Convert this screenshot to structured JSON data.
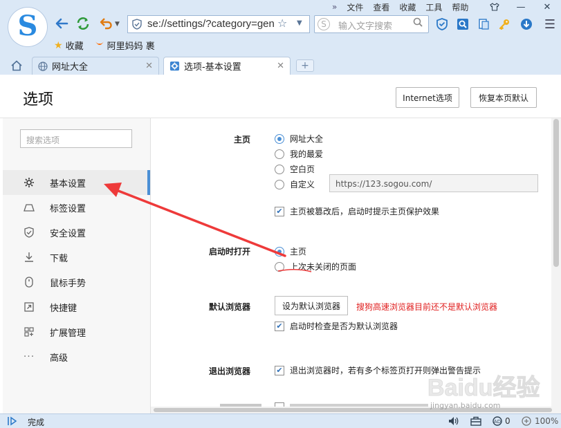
{
  "menu": {
    "chevrons": "»",
    "items": [
      "文件",
      "查看",
      "收藏",
      "工具",
      "帮助"
    ]
  },
  "toolbar": {
    "url": "se://settings/?category=gen",
    "search_placeholder": "输入文字搜索"
  },
  "favorites": [
    {
      "label": "收藏",
      "icon": "star-icon"
    },
    {
      "label": "阿里妈妈 裹",
      "icon": "alimama-icon"
    }
  ],
  "tabs": [
    {
      "label": "网址大全",
      "icon": "globe-icon",
      "active": false
    },
    {
      "label": "选项-基本设置",
      "icon": "gear-icon",
      "active": true
    }
  ],
  "page": {
    "title": "选项",
    "internet_options": "Internet选项",
    "restore_defaults": "恢复本页默认"
  },
  "sidebar": {
    "search_placeholder": "搜索选项",
    "items": [
      {
        "label": "基本设置",
        "icon": "gear-icon",
        "active": true
      },
      {
        "label": "标签设置",
        "icon": "tab-icon",
        "active": false
      },
      {
        "label": "安全设置",
        "icon": "shield-icon",
        "active": false
      },
      {
        "label": "下载",
        "icon": "download-icon",
        "active": false
      },
      {
        "label": "鼠标手势",
        "icon": "mouse-icon",
        "active": false
      },
      {
        "label": "快捷键",
        "icon": "shortcut-icon",
        "active": false
      },
      {
        "label": "扩展管理",
        "icon": "extensions-icon",
        "active": false
      },
      {
        "label": "高级",
        "icon": "more-icon",
        "active": false
      }
    ]
  },
  "settings": {
    "homepage": {
      "label": "主页",
      "options": [
        "网址大全",
        "我的最爱",
        "空白页",
        "自定义"
      ],
      "selected": "网址大全",
      "custom_url": "https://123.sogou.com/",
      "protect_checkbox": "主页被篡改后，启动时提示主页保护效果",
      "protect_checked": true
    },
    "startup": {
      "label": "启动时打开",
      "options": [
        "主页",
        "上次未关闭的页面"
      ],
      "selected": "主页"
    },
    "default_browser": {
      "label": "默认浏览器",
      "button": "设为默认浏览器",
      "warning": "搜狗高速浏览器目前还不是默认浏览器",
      "check_label": "启动时检查是否为默认浏览器",
      "check_checked": true
    },
    "exit_browser": {
      "label": "退出浏览器",
      "check_label": "退出浏览器时，若有多个标签页打开则弹出警告提示",
      "check_checked": true
    }
  },
  "statusbar": {
    "text": "完成",
    "badge_count": "0",
    "zoom": "100%"
  },
  "watermark": {
    "brand": "Baidu经验",
    "url": "jingyan.baidu.com"
  },
  "colors": {
    "accent": "#4a8fd5",
    "warning": "#e02020",
    "annotation_arrow": "#ee3a3a",
    "chrome": "#dbe8f6"
  }
}
